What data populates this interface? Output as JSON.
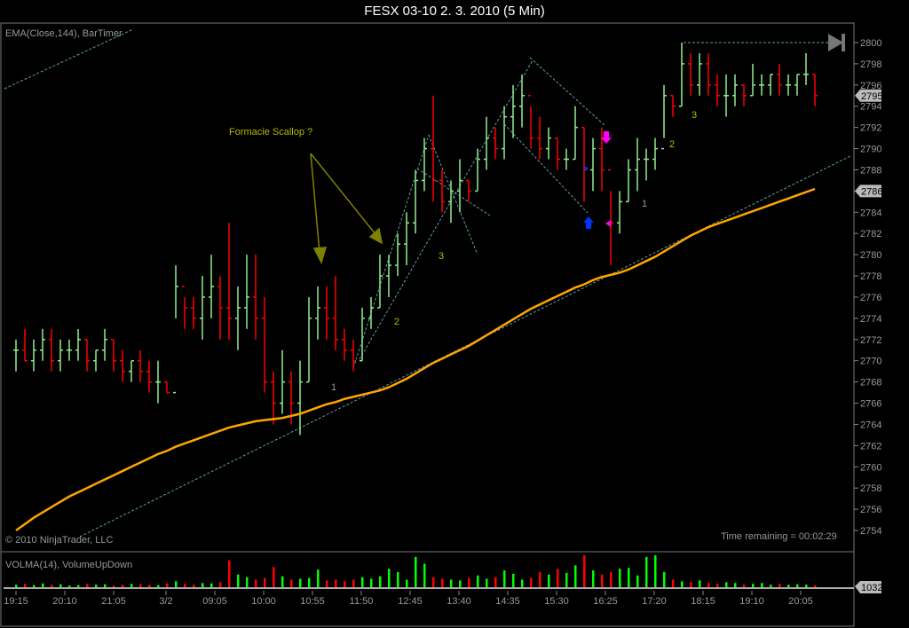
{
  "title": "FESX 03-10  2. 3. 2010 (5 Min)",
  "price_panel": {
    "indicator_label": "EMA(Close,144), BarTimer",
    "copyright": "© 2010 NinjaTrader, LLC",
    "time_remaining": "Time remaining = 00:02:29"
  },
  "volume_panel": {
    "indicator_label": "VOLMA(14), VolumeUpDown",
    "current_marker": "1032"
  },
  "annotations": {
    "scallop": "Formacie Scallop ?",
    "w1": [
      "1",
      "2",
      "3"
    ],
    "w2": [
      "1",
      "2",
      "3"
    ]
  },
  "colors": {
    "up": "#90ee90",
    "down": "#ff0000",
    "ema": "#ffa500",
    "trend": "#5f9ea0",
    "annot": "#808000",
    "vol_up": "#00ff00",
    "vol_down": "#ff0000"
  },
  "chart_data": {
    "type": "ohlc",
    "title": "FESX 03-10  2. 3. 2010 (5 Min)",
    "ylim": [
      2753,
      2801
    ],
    "y_ticks": [
      2754,
      2756,
      2758,
      2760,
      2762,
      2764,
      2766,
      2768,
      2770,
      2772,
      2774,
      2776,
      2778,
      2780,
      2782,
      2784,
      2786,
      2788,
      2790,
      2792,
      2794,
      2796,
      2798,
      2800
    ],
    "price_markers": [
      "2795",
      "2786"
    ],
    "x_ticks": [
      "19:15",
      "20:10",
      "21:05",
      "3/2",
      "09:05",
      "10:00",
      "10:55",
      "11:50",
      "12:45",
      "13:40",
      "14:35",
      "15:30",
      "16:25",
      "17:20",
      "18:15",
      "19:10",
      "20:05"
    ],
    "bars_hlc": [
      [
        2772,
        2769,
        2771
      ],
      [
        2773,
        2770,
        2770
      ],
      [
        2772,
        2769,
        2771
      ],
      [
        2773,
        2770,
        2772
      ],
      [
        2773,
        2769,
        2770
      ],
      [
        2772,
        2769,
        2771
      ],
      [
        2772,
        2770,
        2771
      ],
      [
        2773,
        2770,
        2772
      ],
      [
        2772,
        2769,
        2770
      ],
      [
        2771,
        2769,
        2771
      ],
      [
        2773,
        2770,
        2772
      ],
      [
        2772,
        2769,
        2770
      ],
      [
        2771,
        2768,
        2769
      ],
      [
        2770,
        2768,
        2770
      ],
      [
        2771,
        2768,
        2769
      ],
      [
        2770,
        2767,
        2768
      ],
      [
        2770,
        2766,
        2768
      ],
      [
        2768,
        2767,
        2767
      ],
      [
        2779,
        2774,
        2777
      ],
      [
        2776,
        2773,
        2775
      ],
      [
        2776,
        2773,
        2774
      ],
      [
        2778,
        2772,
        2776
      ],
      [
        2780,
        2774,
        2777
      ],
      [
        2778,
        2772,
        2775
      ],
      [
        2783,
        2772,
        2774
      ],
      [
        2777,
        2771,
        2775
      ],
      [
        2780,
        2773,
        2776
      ],
      [
        2780,
        2772,
        2774
      ],
      [
        2776,
        2767,
        2768
      ],
      [
        2769,
        2764,
        2766
      ],
      [
        2771,
        2765,
        2768
      ],
      [
        2769,
        2764,
        2766
      ],
      [
        2770,
        2763,
        2768
      ],
      [
        2776,
        2768,
        2774
      ],
      [
        2777,
        2772,
        2775
      ],
      [
        2777,
        2772,
        2774
      ],
      [
        2778,
        2771,
        2772
      ],
      [
        2773,
        2770,
        2771
      ],
      [
        2772,
        2769,
        2770
      ],
      [
        2775,
        2770,
        2774
      ],
      [
        2776,
        2773,
        2775
      ],
      [
        2780,
        2775,
        2778
      ],
      [
        2780,
        2776,
        2779
      ],
      [
        2782,
        2778,
        2781
      ],
      [
        2784,
        2779,
        2783
      ],
      [
        2788,
        2782,
        2787
      ],
      [
        2791,
        2786,
        2790
      ],
      [
        2795,
        2785,
        2787
      ],
      [
        2788,
        2784,
        2785
      ],
      [
        2787,
        2783,
        2786
      ],
      [
        2789,
        2784,
        2787
      ],
      [
        2787,
        2785,
        2786
      ],
      [
        2790,
        2786,
        2789
      ],
      [
        2793,
        2788,
        2791
      ],
      [
        2792,
        2789,
        2790
      ],
      [
        2794,
        2789,
        2793
      ],
      [
        2796,
        2791,
        2794
      ],
      [
        2797,
        2792,
        2795
      ],
      [
        2794,
        2790,
        2791
      ],
      [
        2793,
        2789,
        2790
      ],
      [
        2792,
        2789,
        2791
      ],
      [
        2791,
        2788,
        2789
      ],
      [
        2790,
        2788,
        2789
      ],
      [
        2794,
        2789,
        2792
      ],
      [
        2792,
        2785,
        2788
      ],
      [
        2791,
        2786,
        2790
      ],
      [
        2792,
        2786,
        2788
      ],
      [
        2786,
        2779,
        2783
      ],
      [
        2786,
        2782,
        2785
      ],
      [
        2789,
        2785,
        2788
      ],
      [
        2791,
        2786,
        2789
      ],
      [
        2790,
        2787,
        2789
      ],
      [
        2791,
        2788,
        2790
      ],
      [
        2796,
        2791,
        2795
      ],
      [
        2795,
        2793,
        2794
      ],
      [
        2800,
        2794,
        2798
      ],
      [
        2799,
        2795,
        2796
      ],
      [
        2799,
        2795,
        2798
      ],
      [
        2799,
        2795,
        2796
      ],
      [
        2797,
        2794,
        2795
      ],
      [
        2797,
        2793,
        2795
      ],
      [
        2797,
        2794,
        2796
      ],
      [
        2796,
        2794,
        2795
      ],
      [
        2798,
        2795,
        2796
      ],
      [
        2797,
        2795,
        2796
      ],
      [
        2797,
        2795,
        2797
      ],
      [
        2798,
        2795,
        2796
      ],
      [
        2797,
        2795,
        2796
      ],
      [
        2797,
        2795,
        2797
      ],
      [
        2799,
        2796,
        2797
      ],
      [
        2797,
        2794,
        2795
      ]
    ],
    "ema": [
      2754.0,
      2754.6,
      2755.2,
      2755.7,
      2756.2,
      2756.7,
      2757.2,
      2757.6,
      2758.0,
      2758.4,
      2758.8,
      2759.2,
      2759.6,
      2760.0,
      2760.4,
      2760.8,
      2761.2,
      2761.5,
      2761.9,
      2762.2,
      2762.5,
      2762.8,
      2763.1,
      2763.4,
      2763.7,
      2763.9,
      2764.1,
      2764.3,
      2764.4,
      2764.5,
      2764.6,
      2764.8,
      2765.0,
      2765.3,
      2765.6,
      2765.9,
      2766.1,
      2766.4,
      2766.6,
      2766.8,
      2767.0,
      2767.2,
      2767.5,
      2767.9,
      2768.3,
      2768.8,
      2769.3,
      2769.8,
      2770.2,
      2770.6,
      2771.0,
      2771.4,
      2771.9,
      2772.4,
      2772.9,
      2773.4,
      2773.9,
      2774.4,
      2774.9,
      2775.3,
      2775.7,
      2776.1,
      2776.5,
      2776.9,
      2777.2,
      2777.6,
      2777.9,
      2778.1,
      2778.3,
      2778.6,
      2779.0,
      2779.4,
      2779.8,
      2780.3,
      2780.8,
      2781.3,
      2781.8,
      2782.2,
      2782.6,
      2782.9,
      2783.2,
      2783.5,
      2783.8,
      2784.1,
      2784.4,
      2784.7,
      2785.0,
      2785.3,
      2785.6,
      2785.9,
      2786.2
    ],
    "volume": [
      300,
      400,
      250,
      450,
      300,
      350,
      200,
      250,
      400,
      300,
      350,
      200,
      300,
      400,
      350,
      300,
      250,
      450,
      700,
      400,
      300,
      500,
      450,
      600,
      3200,
      1500,
      1200,
      900,
      1100,
      2400,
      1300,
      900,
      1000,
      1100,
      2100,
      800,
      900,
      700,
      900,
      1200,
      1000,
      1300,
      2200,
      1800,
      900,
      3600,
      2800,
      1200,
      1000,
      900,
      800,
      1100,
      1400,
      1000,
      1200,
      2000,
      1600,
      900,
      1100,
      1800,
      1500,
      2200,
      1700,
      2600,
      3800,
      2000,
      1500,
      1800,
      2200,
      2300,
      1400,
      3600,
      3800,
      1800,
      900,
      700,
      600,
      800,
      500,
      400,
      600,
      500,
      300,
      400,
      500,
      300,
      400,
      300,
      350,
      300,
      250
    ]
  }
}
